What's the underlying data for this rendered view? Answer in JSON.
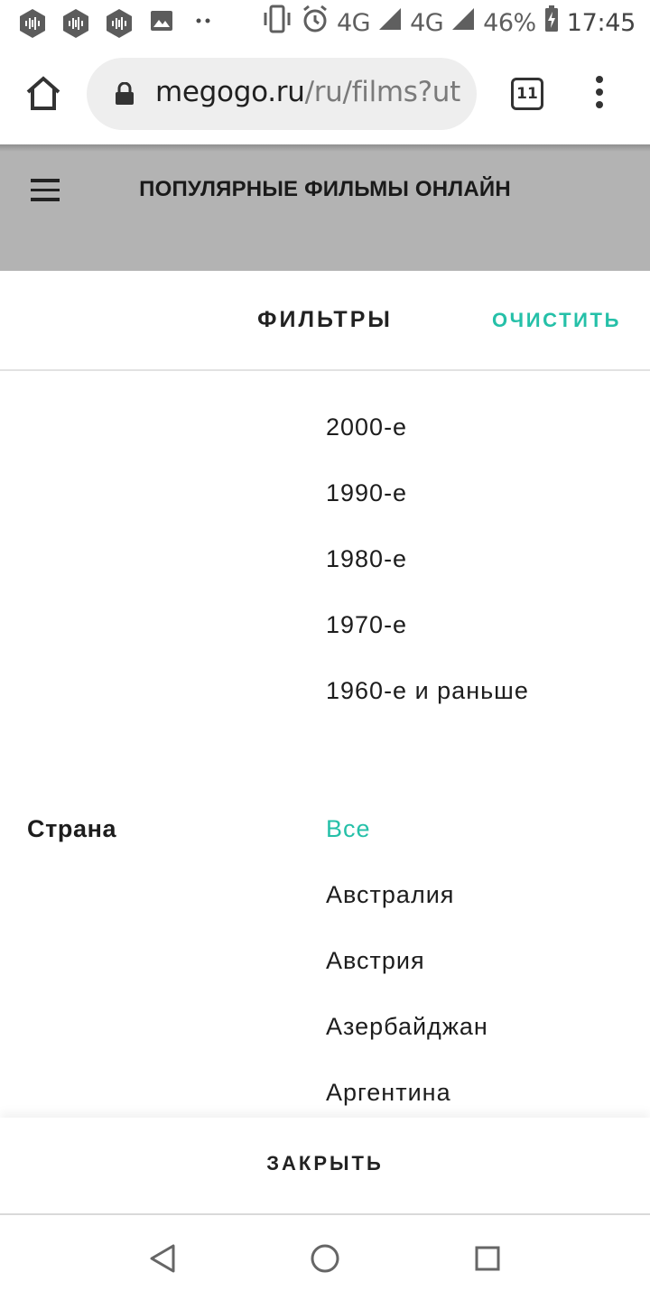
{
  "status_bar": {
    "icons": [
      "podcast-icon",
      "podcast-icon",
      "podcast-icon",
      "image-icon",
      "more-dots-icon",
      "vibrate-icon",
      "alarm-icon",
      "signal-icon",
      "signal-icon"
    ],
    "network_1": "4G",
    "network_2": "4G",
    "battery": "46%",
    "time": "17:45"
  },
  "browser": {
    "url_domain": "megogo.ru",
    "url_path": "/ru/films?utm",
    "tab_count": "11"
  },
  "site": {
    "title": "ПОПУЛЯРНЫЕ ФИЛЬМЫ ОНЛАЙН"
  },
  "filters": {
    "title": "ФИЛЬТРЫ",
    "clear_label": "ОЧИСТИТЬ",
    "decades": [
      "2000-е",
      "1990-е",
      "1980-е",
      "1970-е",
      "1960-е и раньше"
    ],
    "country_label": "Страна",
    "countries": [
      "Все",
      "Австралия",
      "Австрия",
      "Азербайджан",
      "Аргентина"
    ],
    "country_selected": "Все",
    "close_label": "ЗАКРЫТЬ"
  },
  "colors": {
    "accent": "#25c0a8",
    "header_dim": "#b3b3b3"
  }
}
